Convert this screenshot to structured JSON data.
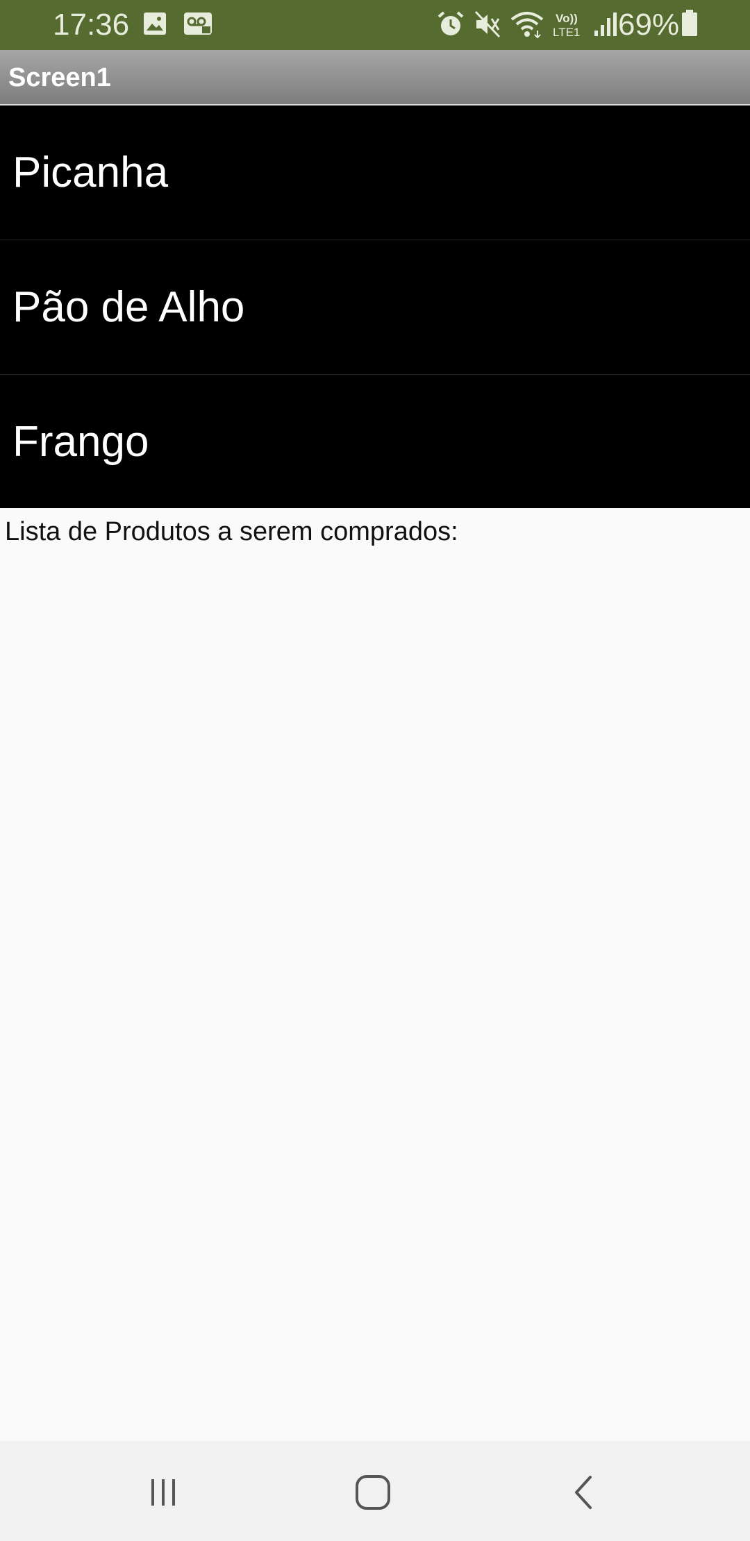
{
  "status_bar": {
    "time": "17:36",
    "battery_percent": "69%",
    "left_icons": [
      "image-icon",
      "voicemail-icon"
    ],
    "right_icons": [
      "alarm-icon",
      "mute-icon",
      "wifi-icon",
      "volte-lte-icon",
      "signal-icon",
      "battery-icon"
    ],
    "volte_label": "Vo))\nLTE1",
    "background_color": "#556b2f"
  },
  "app_bar": {
    "title": "Screen1"
  },
  "list": {
    "items": [
      {
        "label": "Picanha"
      },
      {
        "label": "Pão de Alho"
      },
      {
        "label": "Frango"
      }
    ]
  },
  "caption": "Lista de Produtos a serem comprados:",
  "nav_bar": {
    "buttons": [
      "recents-icon",
      "home-icon",
      "back-icon"
    ]
  }
}
